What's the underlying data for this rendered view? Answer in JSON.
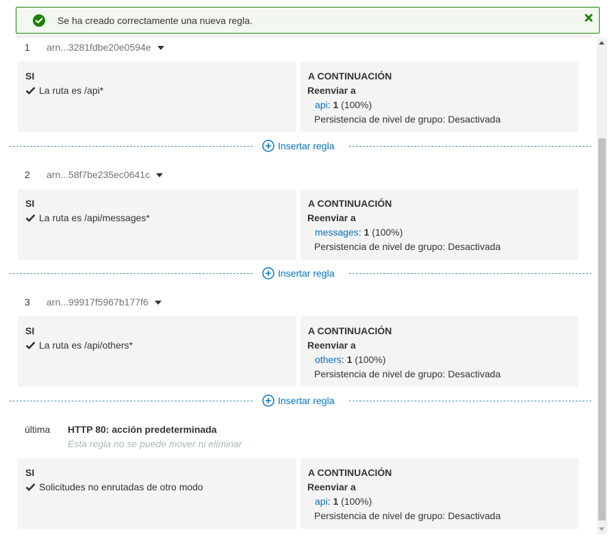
{
  "notification": {
    "message": "Se ha creado correctamente una nueva regla.",
    "status_color": "#1d8102"
  },
  "labels": {
    "if": "SI",
    "then": "A CONTINUACIÓN",
    "forward": "Reenviar a",
    "insert_rule": "Insertar regla",
    "persistence": "Persistencia de nivel de grupo: Desactivada"
  },
  "rules": [
    {
      "number": "1",
      "arn": "arn...3281fdbe20e0594e",
      "condition": "La ruta es /api*",
      "target_name": "api",
      "target_weight_sep": ": ",
      "target_weight": "1",
      "target_pct": " (100%)"
    },
    {
      "number": "2",
      "arn": "arn...58f7be235ec0641c",
      "condition": "La ruta es /api/messages*",
      "target_name": "messages",
      "target_weight_sep": ": ",
      "target_weight": "1",
      "target_pct": " (100%)"
    },
    {
      "number": "3",
      "arn": "arn...99917f5967b177f6",
      "condition": "La ruta es /api/others*",
      "target_name": "others",
      "target_weight_sep": ": ",
      "target_weight": "1",
      "target_pct": " (100%)"
    }
  ],
  "default_rule": {
    "label": "última",
    "title": "HTTP 80: acción predeterminada",
    "note": "Esta regla no se puede mover ni eliminar",
    "condition": "Solicitudes no enrutadas de otro modo",
    "target_name": "api",
    "target_weight_sep": ": ",
    "target_weight": "1",
    "target_pct": " (100%)"
  },
  "colors": {
    "link": "#0073bb",
    "card_bg": "#f4f4f4"
  }
}
